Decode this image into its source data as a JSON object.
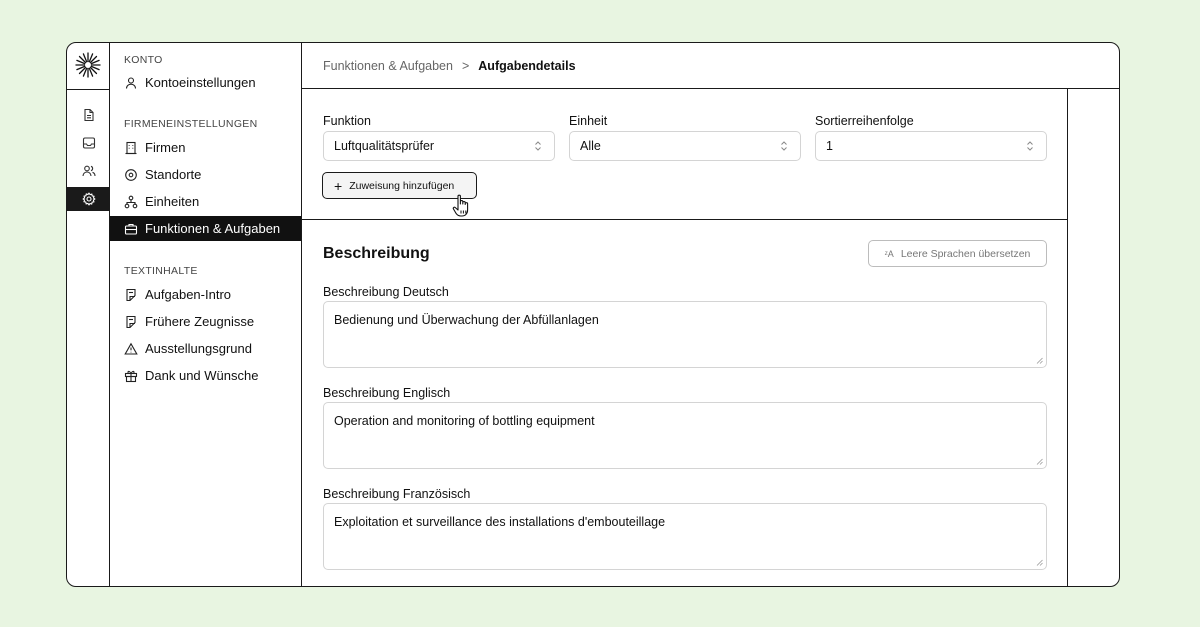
{
  "sidebar": {
    "konto_title": "KONTO",
    "konto_items": [
      {
        "label": "Kontoeinstellungen",
        "icon": "user-icon"
      }
    ],
    "firma_title": "FIRMENEINSTELLUNGEN",
    "firma_items": [
      {
        "label": "Firmen",
        "icon": "building-icon"
      },
      {
        "label": "Standorte",
        "icon": "map-pin-icon"
      },
      {
        "label": "Einheiten",
        "icon": "network-icon"
      },
      {
        "label": "Funktionen & Aufgaben",
        "icon": "briefcase-icon",
        "active": true
      }
    ],
    "text_title": "TEXTINHALTE",
    "text_items": [
      {
        "label": "Aufgaben-Intro",
        "icon": "document-text-icon"
      },
      {
        "label": "Frühere Zeugnisse",
        "icon": "document-text-icon"
      },
      {
        "label": "Ausstellungsgrund",
        "icon": "warning-icon"
      },
      {
        "label": "Dank und Wünsche",
        "icon": "gift-icon"
      }
    ]
  },
  "breadcrumb": {
    "parent": "Funktionen & Aufgaben",
    "separator": ">",
    "current": "Aufgabendetails"
  },
  "filters": {
    "funktion_label": "Funktion",
    "funktion_value": "Luftqualitätsprüfer",
    "einheit_label": "Einheit",
    "einheit_value": "Alle",
    "sort_label": "Sortierreihenfolge",
    "sort_value": "1"
  },
  "add_button": {
    "label": "Zuweisung hinzufügen"
  },
  "description": {
    "title": "Beschreibung",
    "translate_button": "Leere Sprachen übersetzen",
    "fields": [
      {
        "label": "Beschreibung Deutsch",
        "value": "Bedienung und Überwachung der Abfüllanlagen"
      },
      {
        "label": "Beschreibung Englisch",
        "value": "Operation and monitoring of bottling equipment"
      },
      {
        "label": "Beschreibung Französisch",
        "value": "Exploitation et surveillance des installations d'embouteillage"
      }
    ]
  },
  "colors": {
    "page_bg": "#e8f5e1",
    "active_bg": "#111111",
    "border": "#1a1a1a"
  }
}
